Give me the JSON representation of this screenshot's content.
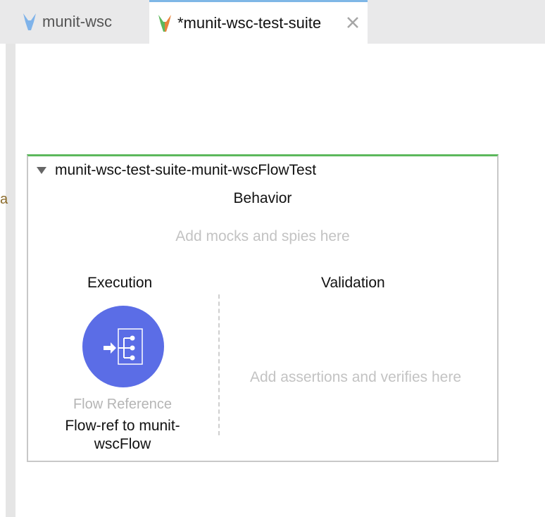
{
  "tabs": [
    {
      "label": "munit-wsc",
      "icon": "munit-icon",
      "active": false
    },
    {
      "label": "*munit-wsc-test-suite",
      "icon": "munit-suite-icon",
      "active": true,
      "close_icon": "close-icon"
    }
  ],
  "stray_text": "a",
  "suite": {
    "name": "munit-wsc-test-suite-munit-wscFlowTest",
    "behavior": {
      "title": "Behavior",
      "hint": "Add mocks and spies here"
    },
    "execution": {
      "title": "Execution",
      "component": {
        "type": "Flow Reference",
        "name": "Flow-ref to munit-wscFlow",
        "icon": "flow-reference-icon",
        "color": "#5b6de6"
      }
    },
    "validation": {
      "title": "Validation",
      "hint": "Add assertions and verifies here"
    }
  },
  "colors": {
    "accent_tab": "#7fb7e6",
    "suite_top": "#5cb85c"
  }
}
